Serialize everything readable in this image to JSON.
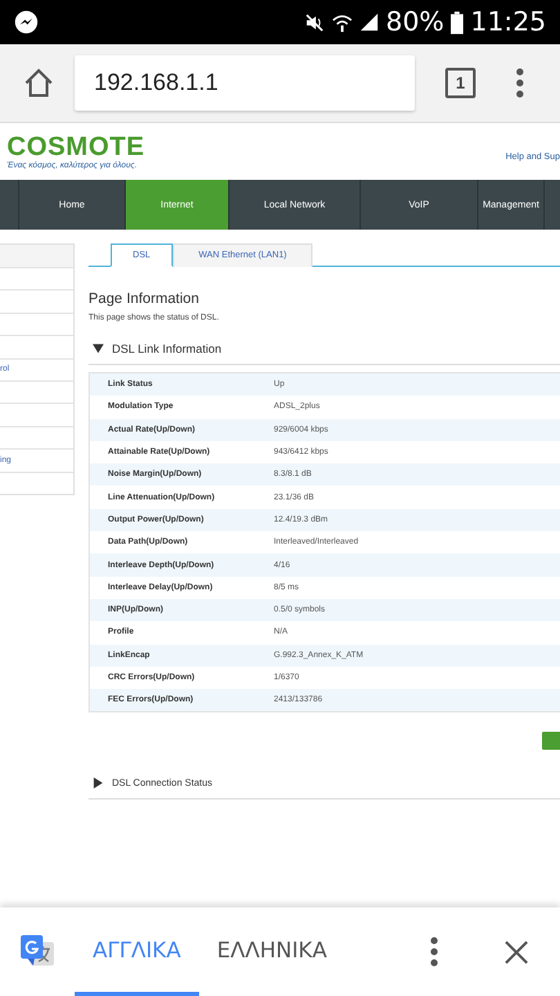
{
  "status_bar": {
    "battery": "80%",
    "time": "11:25"
  },
  "browser": {
    "url": "192.168.1.1",
    "tab_count": "1"
  },
  "header": {
    "logo": "COSMOTE",
    "tagline": "Ένας κόσμος, καλύτερος για όλους.",
    "help_link": "Help and Sup"
  },
  "nav": [
    {
      "label": "Home",
      "selected": false
    },
    {
      "label": "Internet",
      "selected": true
    },
    {
      "label": "Local Network",
      "selected": false
    },
    {
      "label": "VoIP",
      "selected": false
    },
    {
      "label": "Management",
      "selected": false
    }
  ],
  "sidebar": {
    "items": [
      {
        "kind": "header"
      },
      {
        "kind": "item"
      },
      {
        "kind": "item"
      },
      {
        "kind": "item"
      },
      {
        "kind": "item"
      },
      {
        "kind": "item",
        "label": "rol"
      },
      {
        "kind": "item"
      },
      {
        "kind": "item"
      },
      {
        "kind": "item"
      },
      {
        "kind": "item",
        "label": "ing"
      },
      {
        "kind": "item"
      }
    ]
  },
  "tabs": [
    {
      "label": "DSL",
      "selected": true
    },
    {
      "label": "WAN Ethernet (LAN1)",
      "selected": false
    }
  ],
  "page_info": {
    "title": "Page Information",
    "description": "This page shows the status of DSL."
  },
  "sections": [
    {
      "title": "DSL Link Information",
      "expanded": true,
      "rows": [
        {
          "label": "Link Status",
          "value": "Up"
        },
        {
          "label": "Modulation Type",
          "value": "ADSL_2plus"
        },
        {
          "label": "Actual Rate(Up/Down)",
          "value": "929/6004 kbps"
        },
        {
          "label": "Attainable Rate(Up/Down)",
          "value": "943/6412 kbps"
        },
        {
          "label": "Noise Margin(Up/Down)",
          "value": "8.3/8.1 dB"
        },
        {
          "label": "Line Attenuation(Up/Down)",
          "value": "23.1/36 dB"
        },
        {
          "label": "Output Power(Up/Down)",
          "value": "12.4/19.3 dBm"
        },
        {
          "label": "Data Path(Up/Down)",
          "value": "Interleaved/Interleaved"
        },
        {
          "label": "Interleave Depth(Up/Down)",
          "value": "4/16"
        },
        {
          "label": "Interleave Delay(Up/Down)",
          "value": "8/5 ms"
        },
        {
          "label": "INP(Up/Down)",
          "value": "0.5/0 symbols"
        },
        {
          "label": "Profile",
          "value": "N/A"
        },
        {
          "label": "LinkEncap",
          "value": "G.992.3_Annex_K_ATM"
        },
        {
          "label": "CRC Errors(Up/Down)",
          "value": "1/6370"
        },
        {
          "label": "FEC Errors(Up/Down)",
          "value": "2413/133786"
        }
      ]
    },
    {
      "title": "DSL Connection Status",
      "expanded": false
    }
  ],
  "translate_bar": {
    "languages": [
      {
        "label": "ΑΓΓΛΙΚΑ",
        "selected": true
      },
      {
        "label": "ΕΛΛΗΝΙΚΑ",
        "selected": false
      }
    ]
  }
}
